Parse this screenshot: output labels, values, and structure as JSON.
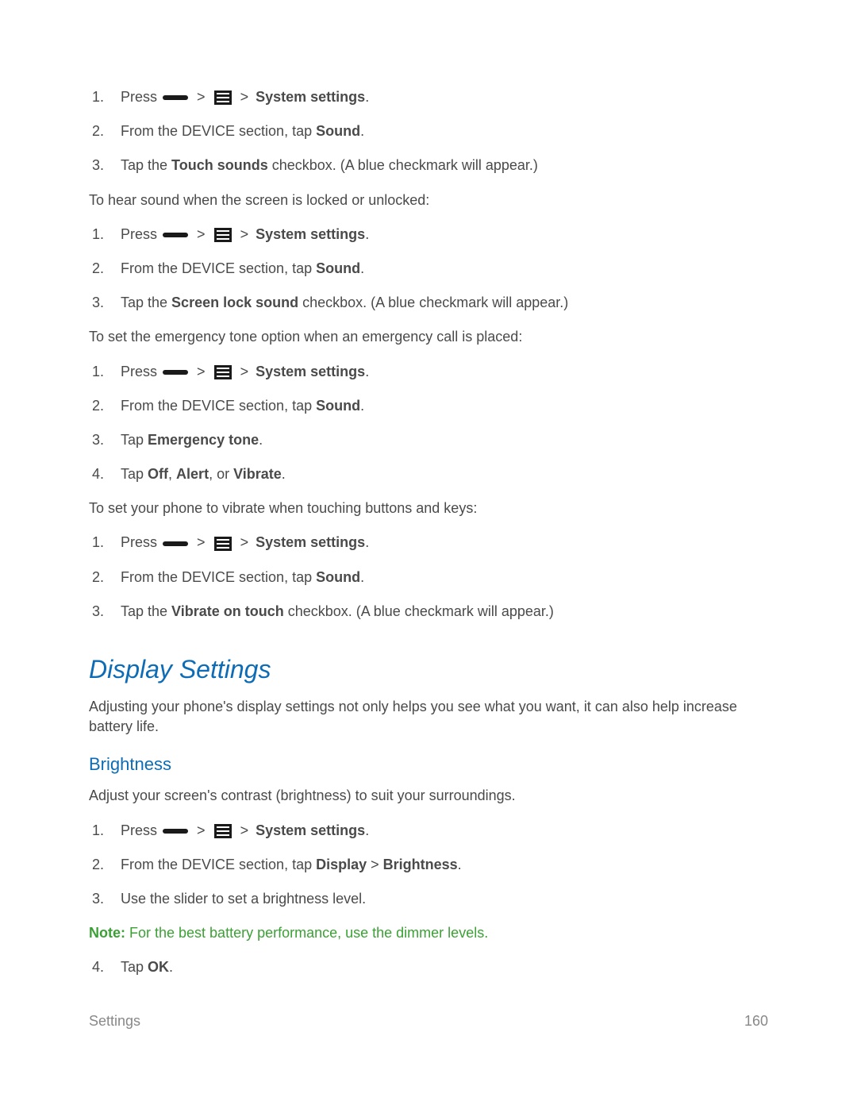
{
  "common": {
    "press": "Press",
    "gt": ">",
    "system_settings": "System settings",
    "period": "."
  },
  "sections": {
    "touch_sounds": {
      "step2_pre": "From the DEVICE section, tap ",
      "step2_bold": "Sound",
      "step2_post": ".",
      "step3_pre": "Tap the ",
      "step3_bold": "Touch sounds",
      "step3_post": " checkbox. (A blue checkmark will appear.)"
    },
    "screen_lock": {
      "intro": "To hear sound when the screen is locked or unlocked:",
      "step2_pre": "From the DEVICE section, tap ",
      "step2_bold": "Sound",
      "step2_post": ".",
      "step3_pre": "Tap the ",
      "step3_bold": "Screen lock sound",
      "step3_post": " checkbox. (A blue checkmark will appear.)"
    },
    "emergency": {
      "intro": "To set the emergency tone option when an emergency call is placed:",
      "step2_pre": "From the DEVICE section, tap ",
      "step2_bold": "Sound",
      "step2_post": ".",
      "step3_pre": "Tap ",
      "step3_bold": "Emergency tone",
      "step3_post": ".",
      "step4_pre": "Tap ",
      "step4_b1": "Off",
      "step4_sep1": ", ",
      "step4_b2": "Alert",
      "step4_sep2": ", or ",
      "step4_b3": "Vibrate",
      "step4_post": "."
    },
    "vibrate_touch": {
      "intro": "To set your phone to vibrate when touching buttons and keys:",
      "step2_pre": "From the DEVICE section, tap ",
      "step2_bold": "Sound",
      "step2_post": ".",
      "step3_pre": "Tap the ",
      "step3_bold": "Vibrate on touch",
      "step3_post": " checkbox. (A blue checkmark will appear.)"
    }
  },
  "display": {
    "title": "Display Settings",
    "intro": "Adjusting your phone's display settings not only helps you see what you want, it can also help increase battery life.",
    "brightness": {
      "title": "Brightness",
      "intro": "Adjust your screen's contrast (brightness) to suit your surroundings.",
      "step2_pre": "From the DEVICE section, tap ",
      "step2_b1": "Display",
      "step2_sep": " > ",
      "step2_b2": "Brightness",
      "step2_post": ".",
      "step3": "Use the slider to set a brightness level.",
      "note_label": "Note:",
      "note_text": "  For the best battery performance, use the dimmer levels.",
      "step4_pre": "Tap ",
      "step4_bold": "OK",
      "step4_post": "."
    }
  },
  "footer": {
    "section": "Settings",
    "page": "160"
  }
}
